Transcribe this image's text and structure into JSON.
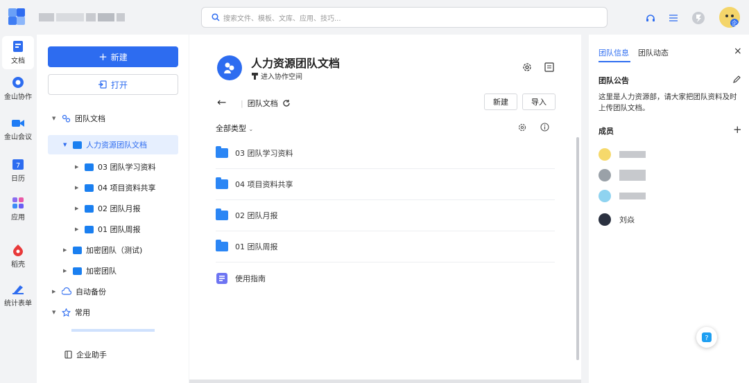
{
  "search": {
    "placeholder": "搜索文件、模板、文库、应用、技巧..."
  },
  "rail": {
    "items": [
      {
        "label": "文档",
        "icon": "docs-icon"
      },
      {
        "label": "金山协作",
        "icon": "collab-icon"
      },
      {
        "label": "金山会议",
        "icon": "meeting-icon"
      },
      {
        "label": "日历",
        "icon": "calendar-icon",
        "date": "7"
      },
      {
        "label": "应用",
        "icon": "apps-icon"
      },
      {
        "label": "稻壳",
        "icon": "docer-icon"
      },
      {
        "label": "统计表单",
        "icon": "form-icon"
      }
    ]
  },
  "tree": {
    "new_label": "新建",
    "open_label": "打开",
    "nodes": [
      {
        "label": "团队文档"
      },
      {
        "label": "人力资源团队文档"
      },
      {
        "label": "03 团队学习资料"
      },
      {
        "label": "04 项目资料共享"
      },
      {
        "label": "02 团队月报"
      },
      {
        "label": "01 团队周报"
      },
      {
        "label": "加密团队（测试)"
      },
      {
        "label": "加密团队"
      },
      {
        "label": "自动备份"
      },
      {
        "label": "常用"
      }
    ],
    "assistant_label": "企业助手"
  },
  "main": {
    "title": "人力资源团队文档",
    "subtitle": "进入协作空间",
    "breadcrumb": "团队文档",
    "new_label": "新建",
    "import_label": "导入",
    "filter_label": "全部类型",
    "files": [
      {
        "name": "03 团队学习资料",
        "type": "folder"
      },
      {
        "name": "04 项目资料共享",
        "type": "folder"
      },
      {
        "name": "02 团队月报",
        "type": "folder"
      },
      {
        "name": "01 团队周报",
        "type": "folder"
      },
      {
        "name": "使用指南",
        "type": "doc"
      }
    ]
  },
  "right": {
    "tab_info": "团队信息",
    "tab_activity": "团队动态",
    "notice_title": "团队公告",
    "notice_text_1": "这里是人力资源部，请大家把团队资料及时",
    "notice_text_2": "上传团队文档。",
    "members_title": "成员",
    "members": [
      {
        "name": ""
      },
      {
        "name": ""
      },
      {
        "name": ""
      },
      {
        "name": "刘焱"
      }
    ]
  },
  "colors": {
    "accent": "#2d6cf0",
    "folder": "#1a7ff0"
  }
}
